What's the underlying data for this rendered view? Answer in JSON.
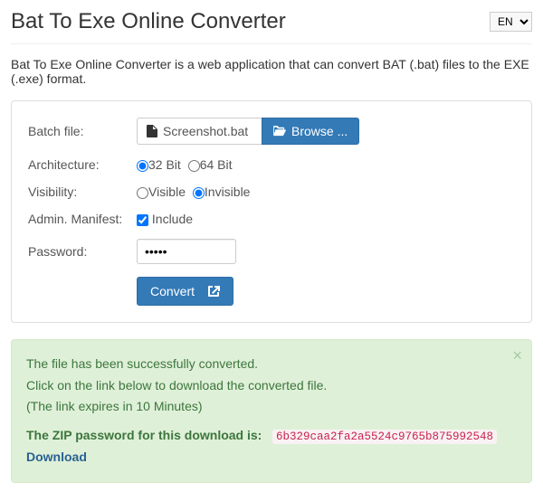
{
  "header": {
    "title": "Bat To Exe Online Converter",
    "lang_selected": "EN"
  },
  "description": "Bat To Exe Online Converter is a web application that can convert BAT (.bat) files to the EXE (.exe) format.",
  "form": {
    "batch_label": "Batch file:",
    "batch_filename": "Screenshot.bat",
    "browse_label": "Browse ...",
    "arch_label": "Architecture:",
    "arch_32": "32 Bit",
    "arch_64": "64 Bit",
    "vis_label": "Visibility:",
    "vis_visible": "Visible",
    "vis_invisible": "Invisible",
    "manifest_label": "Admin. Manifest:",
    "manifest_include": "Include",
    "password_label": "Password:",
    "password_value": "•••••",
    "convert_label": "Convert"
  },
  "alert": {
    "line1": "The file has been successfully converted.",
    "line2": "Click on the link below to download the converted file.",
    "line3": "(The link expires in 10 Minutes)",
    "pwd_label": "The ZIP password for this download is:",
    "pwd_value": "6b329caa2fa2a5524c9765b875992548",
    "download_label": "Download"
  }
}
